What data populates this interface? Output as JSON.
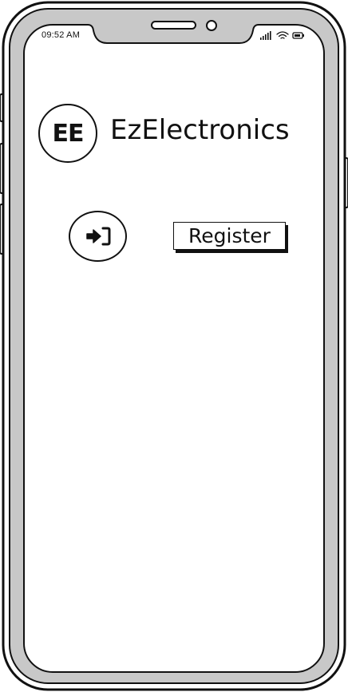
{
  "status_bar": {
    "time": "09:52 AM",
    "icons": [
      "signal-icon",
      "wifi-icon",
      "battery-icon"
    ]
  },
  "header": {
    "logo_text": "EE",
    "brand_name": "EzElectronics"
  },
  "actions": {
    "login_icon": "login-icon",
    "register_label": "Register"
  }
}
